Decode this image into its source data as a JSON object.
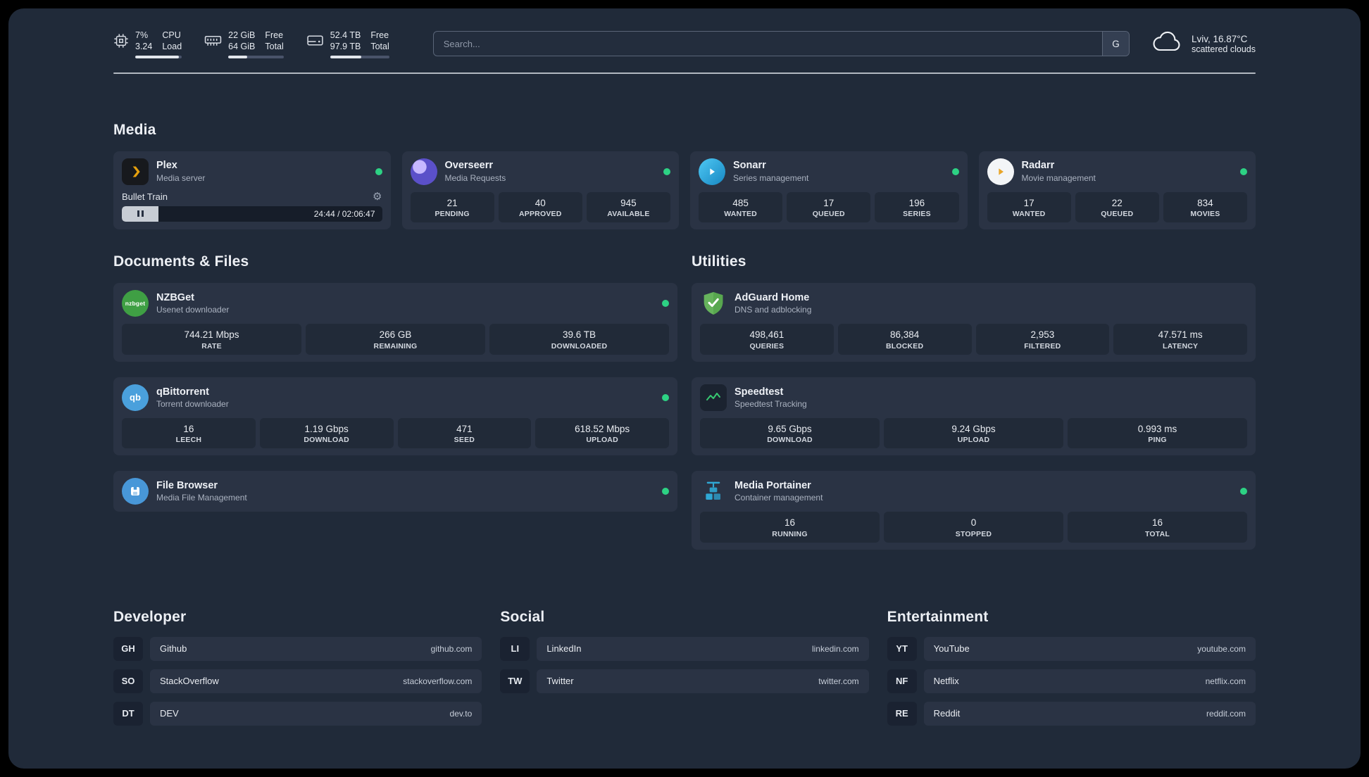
{
  "colors": {
    "status_online": "#2dd284",
    "plex_accent": "#e5a00d",
    "adguard_green": "#66b35c",
    "speedtest_green": "#37c871",
    "portainer_blue": "#2fa8d5"
  },
  "topbar": {
    "cpu": {
      "value_top": "7%",
      "value_bottom": "3.24",
      "label_top": "CPU",
      "label_bottom": "Load",
      "bar_fraction": 93
    },
    "memory": {
      "value_top": "22 GiB",
      "value_bottom": "64 GiB",
      "label_top": "Free",
      "label_bottom": "Total",
      "bar_fraction": 34
    },
    "disk": {
      "value_top": "52.4 TB",
      "value_bottom": "97.9 TB",
      "label_top": "Free",
      "label_bottom": "Total",
      "bar_fraction": 53
    },
    "search": {
      "placeholder": "Search...",
      "provider_label": "G"
    },
    "weather": {
      "location": "Lviv, 16.87°C",
      "condition": "scattered clouds"
    }
  },
  "sections": {
    "media": {
      "title": "Media",
      "cards": [
        {
          "name": "Plex",
          "description": "Media server",
          "player": {
            "track": "Bullet Train",
            "time": "24:44 / 02:06:47"
          }
        },
        {
          "name": "Overseerr",
          "description": "Media Requests",
          "stats": [
            {
              "value": "21",
              "label": "PENDING"
            },
            {
              "value": "40",
              "label": "APPROVED"
            },
            {
              "value": "945",
              "label": "AVAILABLE"
            }
          ]
        },
        {
          "name": "Sonarr",
          "description": "Series management",
          "stats": [
            {
              "value": "485",
              "label": "WANTED"
            },
            {
              "value": "17",
              "label": "QUEUED"
            },
            {
              "value": "196",
              "label": "SERIES"
            }
          ]
        },
        {
          "name": "Radarr",
          "description": "Movie management",
          "stats": [
            {
              "value": "17",
              "label": "WANTED"
            },
            {
              "value": "22",
              "label": "QUEUED"
            },
            {
              "value": "834",
              "label": "MOVIES"
            }
          ]
        }
      ]
    },
    "documents": {
      "title": "Documents & Files",
      "cards": [
        {
          "name": "NZBGet",
          "description": "Usenet downloader",
          "stats": [
            {
              "value": "744.21 Mbps",
              "label": "RATE"
            },
            {
              "value": "266 GB",
              "label": "REMAINING"
            },
            {
              "value": "39.6 TB",
              "label": "DOWNLOADED"
            }
          ]
        },
        {
          "name": "qBittorrent",
          "description": "Torrent downloader",
          "stats": [
            {
              "value": "16",
              "label": "LEECH"
            },
            {
              "value": "1.19 Gbps",
              "label": "DOWNLOAD"
            },
            {
              "value": "471",
              "label": "SEED"
            },
            {
              "value": "618.52 Mbps",
              "label": "UPLOAD"
            }
          ]
        },
        {
          "name": "File Browser",
          "description": "Media File Management"
        }
      ]
    },
    "utilities": {
      "title": "Utilities",
      "cards": [
        {
          "name": "AdGuard Home",
          "description": "DNS and adblocking",
          "stats": [
            {
              "value": "498,461",
              "label": "QUERIES"
            },
            {
              "value": "86,384",
              "label": "BLOCKED"
            },
            {
              "value": "2,953",
              "label": "FILTERED"
            },
            {
              "value": "47.571 ms",
              "label": "LATENCY"
            }
          ]
        },
        {
          "name": "Speedtest",
          "description": "Speedtest Tracking",
          "stats": [
            {
              "value": "9.65 Gbps",
              "label": "DOWNLOAD"
            },
            {
              "value": "9.24 Gbps",
              "label": "UPLOAD"
            },
            {
              "value": "0.993 ms",
              "label": "PING"
            }
          ]
        },
        {
          "name": "Media Portainer",
          "description": "Container management",
          "stats": [
            {
              "value": "16",
              "label": "RUNNING"
            },
            {
              "value": "0",
              "label": "STOPPED"
            },
            {
              "value": "16",
              "label": "TOTAL"
            }
          ]
        }
      ]
    }
  },
  "bookmarks": {
    "developer": {
      "title": "Developer",
      "items": [
        {
          "abbr": "GH",
          "name": "Github",
          "domain": "github.com"
        },
        {
          "abbr": "SO",
          "name": "StackOverflow",
          "domain": "stackoverflow.com"
        },
        {
          "abbr": "DT",
          "name": "DEV",
          "domain": "dev.to"
        }
      ]
    },
    "social": {
      "title": "Social",
      "items": [
        {
          "abbr": "LI",
          "name": "LinkedIn",
          "domain": "linkedin.com"
        },
        {
          "abbr": "TW",
          "name": "Twitter",
          "domain": "twitter.com"
        }
      ]
    },
    "entertainment": {
      "title": "Entertainment",
      "items": [
        {
          "abbr": "YT",
          "name": "YouTube",
          "domain": "youtube.com"
        },
        {
          "abbr": "NF",
          "name": "Netflix",
          "domain": "netflix.com"
        },
        {
          "abbr": "RE",
          "name": "Reddit",
          "domain": "reddit.com"
        }
      ]
    }
  }
}
